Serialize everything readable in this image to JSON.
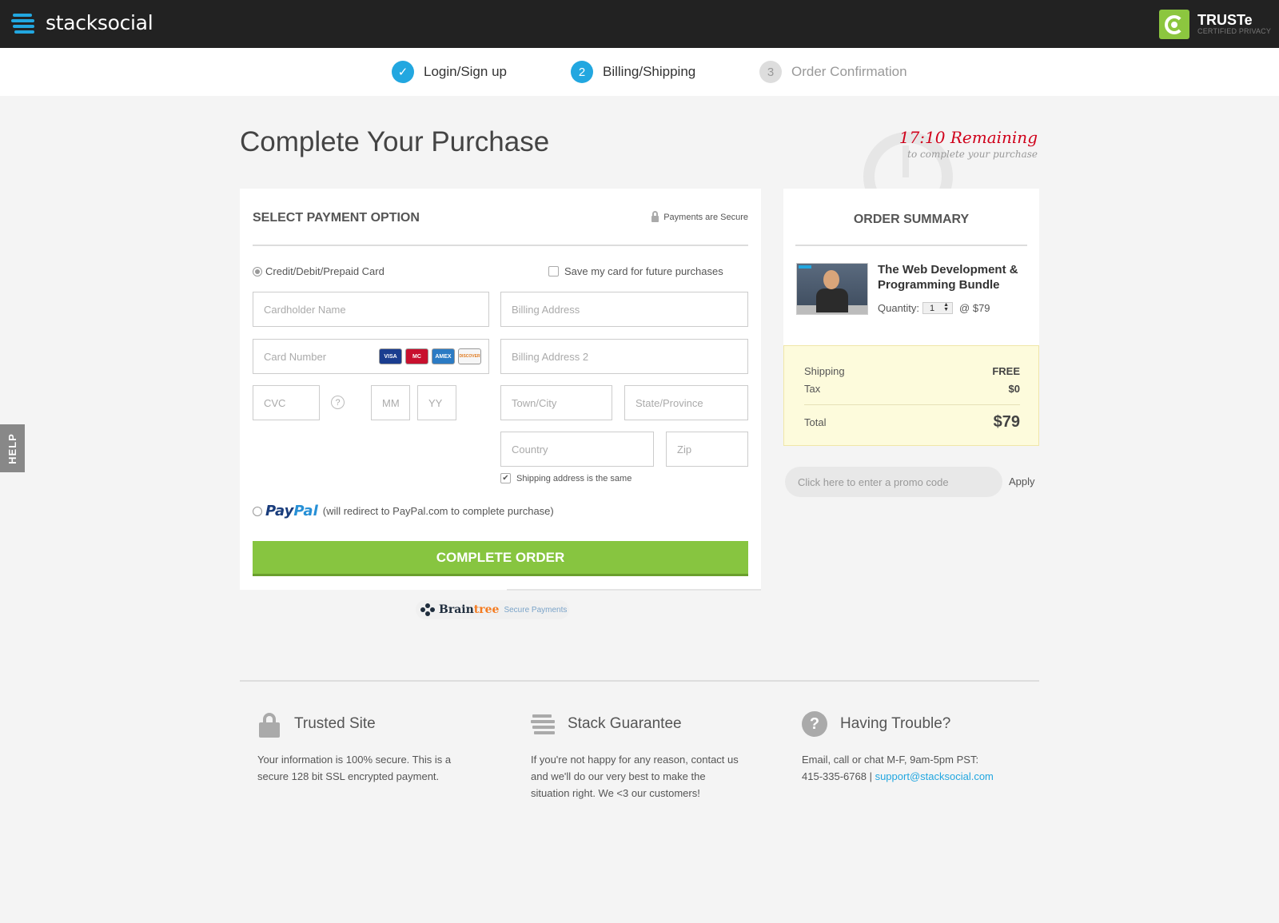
{
  "header": {
    "logo_text": "stacksocial",
    "truste": {
      "name": "TRUSTe",
      "tagline": "CERTIFIED PRIVACY"
    }
  },
  "steps": [
    {
      "number": "✓",
      "label": "Login/Sign up",
      "state": "done"
    },
    {
      "number": "2",
      "label": "Billing/Shipping",
      "state": "active"
    },
    {
      "number": "3",
      "label": "Order Confirmation",
      "state": "pending"
    }
  ],
  "page_title": "Complete Your Purchase",
  "timer": {
    "remaining": "17:10 Remaining",
    "subtext": "to complete your purchase"
  },
  "payment": {
    "heading": "SELECT PAYMENT OPTION",
    "secure_label": "Payments are Secure",
    "card_option_label": "Credit/Debit/Prepaid Card",
    "save_card_label": "Save my card for future purchases",
    "placeholders": {
      "cardholder": "Cardholder Name",
      "card_number": "Card Number",
      "cvc": "CVC",
      "mm": "MM",
      "yy": "YY",
      "billing1": "Billing Address",
      "billing2": "Billing Address 2",
      "town": "Town/City",
      "state": "State/Province",
      "country": "Country",
      "zip": "Zip"
    },
    "card_brands": [
      "VISA",
      "MC",
      "AMEX",
      "DISCOVER"
    ],
    "cvc_help": "?",
    "shipping_same_label": "Shipping address is the same",
    "shipping_same_checked": true,
    "paypal_logo_1": "Pay",
    "paypal_logo_2": "Pal",
    "paypal_note": "(will redirect to PayPal.com to complete purchase)",
    "complete_button": "COMPLETE ORDER"
  },
  "braintree": {
    "brain": "Brain",
    "tree": "tree",
    "secure": "Secure Payments"
  },
  "summary": {
    "title": "ORDER SUMMARY",
    "product_title": "The Web Development & Programming Bundle",
    "quantity_label": "Quantity:",
    "quantity_value": "1",
    "unit_price": "@ $79",
    "shipping_label": "Shipping",
    "shipping_value": "FREE",
    "tax_label": "Tax",
    "tax_value": "$0",
    "total_label": "Total",
    "total_value": "$79"
  },
  "promo": {
    "placeholder": "Click here to enter a promo code",
    "apply": "Apply"
  },
  "help_tab": "HELP",
  "footer": {
    "trusted": {
      "title": "Trusted Site",
      "body": "Your information is 100% secure. This is a secure 128 bit SSL encrypted payment."
    },
    "guarantee": {
      "title": "Stack Guarantee",
      "body": "If you're not happy for any reason, contact us and we'll do our very best to make the situation right. We <3 our customers!"
    },
    "trouble": {
      "title": "Having Trouble?",
      "line1": "Email, call or chat M-F, 9am-5pm PST:",
      "phone": "415-335-6768 |",
      "email": "support@stacksocial.com"
    }
  }
}
